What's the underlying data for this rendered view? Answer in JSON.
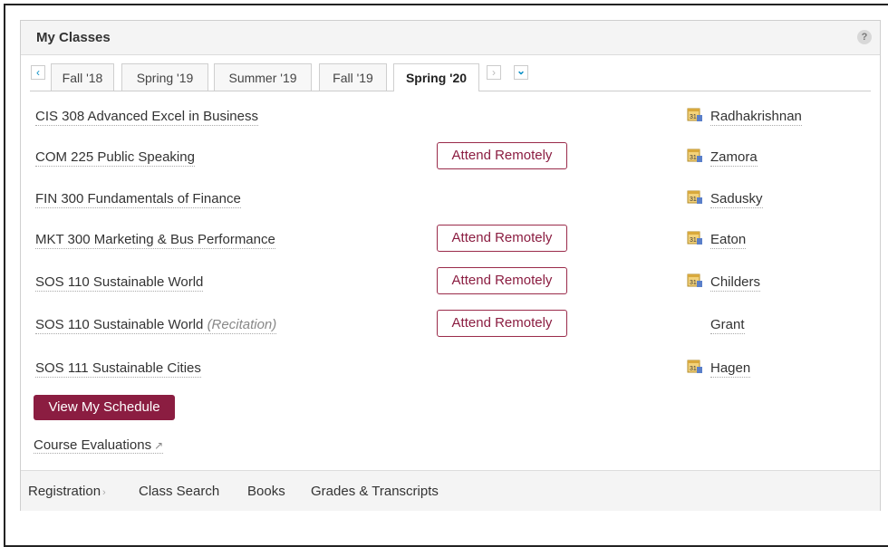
{
  "widget": {
    "title": "My Classes",
    "help_icon": "?"
  },
  "terms": {
    "prev_label": "‹",
    "next_label": "›",
    "dropdown_label": "⌄",
    "tabs": [
      {
        "label": "Fall '18",
        "active": false
      },
      {
        "label": "Spring '19",
        "active": false
      },
      {
        "label": "Summer '19",
        "active": false
      },
      {
        "label": "Fall '19",
        "active": false
      },
      {
        "label": "Spring '20",
        "active": true
      }
    ]
  },
  "classes": [
    {
      "course": "CIS 308 Advanced Excel in Business",
      "note": "",
      "remote": "",
      "instructor": "Radhakrishnan",
      "has_calendar": true
    },
    {
      "course": "COM 225 Public Speaking",
      "note": "",
      "remote": "Attend Remotely",
      "instructor": "Zamora",
      "has_calendar": true
    },
    {
      "course": "FIN 300 Fundamentals of Finance",
      "note": "",
      "remote": "",
      "instructor": "Sadusky",
      "has_calendar": true
    },
    {
      "course": "MKT 300 Marketing & Bus Performance",
      "note": "",
      "remote": "Attend Remotely",
      "instructor": "Eaton",
      "has_calendar": true
    },
    {
      "course": "SOS 110 Sustainable World",
      "note": "",
      "remote": "Attend Remotely",
      "instructor": "Childers",
      "has_calendar": true
    },
    {
      "course": "SOS 110 Sustainable World",
      "note": "(Recitation)",
      "remote": "Attend Remotely",
      "instructor": "Grant",
      "has_calendar": false
    },
    {
      "course": "SOS 111 Sustainable Cities",
      "note": "",
      "remote": "",
      "instructor": "Hagen",
      "has_calendar": true
    }
  ],
  "actions": {
    "schedule_label": "View My Schedule",
    "evaluations_label": "Course Evaluations",
    "external_icon": "↗"
  },
  "footer": {
    "registration": "Registration",
    "registration_chevron": "›",
    "class_search": "Class Search",
    "books": "Books",
    "grades": "Grades & Transcripts"
  },
  "colors": {
    "accent": "#8b1d41",
    "link_blue": "#0a8fc6"
  }
}
